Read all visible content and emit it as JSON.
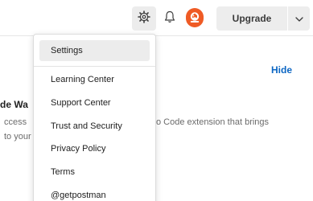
{
  "header": {
    "upgrade_label": "Upgrade",
    "icons": {
      "settings": "gear-icon",
      "notifications": "bell-icon",
      "avatar": "postman-avatar",
      "caret": "chevron-down-icon"
    }
  },
  "background": {
    "hide_label": "Hide",
    "heading_fragment": "de Wa",
    "line1_left": "ccess",
    "line1_right": "o Code extension that brings",
    "line2_left": "to your"
  },
  "settings_menu": {
    "items": [
      {
        "label": "Settings",
        "active": true
      },
      {
        "label": "Learning Center"
      },
      {
        "label": "Support Center"
      },
      {
        "label": "Trust and Security"
      },
      {
        "label": "Privacy Policy"
      },
      {
        "label": "Terms"
      },
      {
        "label": "@getpostman"
      }
    ]
  },
  "colors": {
    "accent_link": "#0b66c3",
    "avatar_orange": "#ef5b25",
    "active_item_bg": "#ececec",
    "button_bg": "#ededed"
  }
}
